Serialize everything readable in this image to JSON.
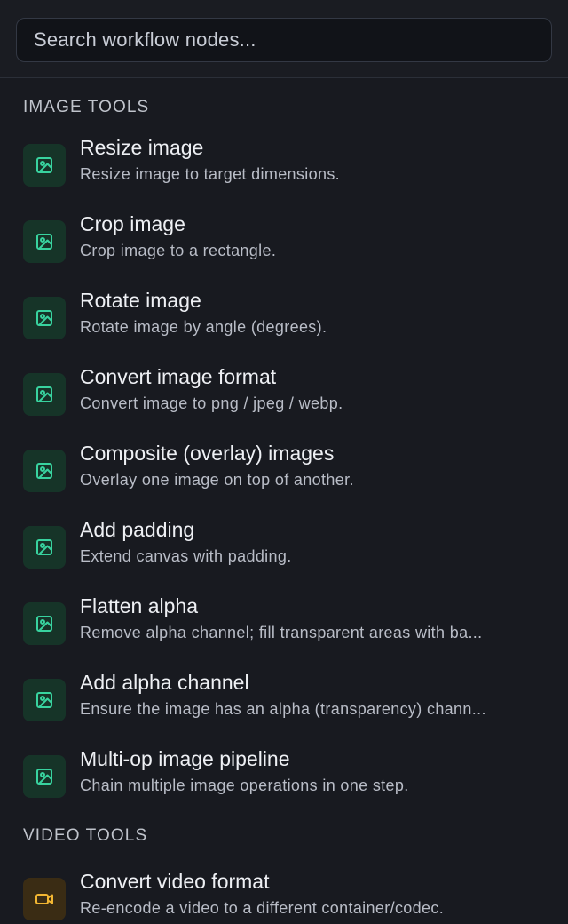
{
  "search": {
    "placeholder": "Search workflow nodes..."
  },
  "sections": [
    {
      "title": "IMAGE TOOLS",
      "items": [
        {
          "icon": "image-icon",
          "title": "Resize image",
          "description": "Resize image to target dimensions."
        },
        {
          "icon": "image-icon",
          "title": "Crop image",
          "description": "Crop image to a rectangle."
        },
        {
          "icon": "image-icon",
          "title": "Rotate image",
          "description": "Rotate image by angle (degrees)."
        },
        {
          "icon": "image-icon",
          "title": "Convert image format",
          "description": "Convert image to png / jpeg / webp."
        },
        {
          "icon": "image-icon",
          "title": "Composite (overlay) images",
          "description": "Overlay one image on top of another."
        },
        {
          "icon": "image-icon",
          "title": "Add padding",
          "description": "Extend canvas with padding."
        },
        {
          "icon": "image-icon",
          "title": "Flatten alpha",
          "description": "Remove alpha channel; fill transparent areas with ba..."
        },
        {
          "icon": "image-icon",
          "title": "Add alpha channel",
          "description": "Ensure the image has an alpha (transparency) chann..."
        },
        {
          "icon": "image-icon",
          "title": "Multi-op image pipeline",
          "description": "Chain multiple image operations in one step."
        }
      ]
    },
    {
      "title": "VIDEO TOOLS",
      "items": [
        {
          "icon": "video-camera-icon",
          "title": "Convert video format",
          "description": "Re-encode a video to a different container/codec."
        }
      ]
    }
  ],
  "colors": {
    "background": "#181a20",
    "image_icon_bg": "#163428",
    "image_icon": "#38d39f",
    "video_icon_bg": "#3a2c14",
    "video_icon": "#f2b632"
  }
}
